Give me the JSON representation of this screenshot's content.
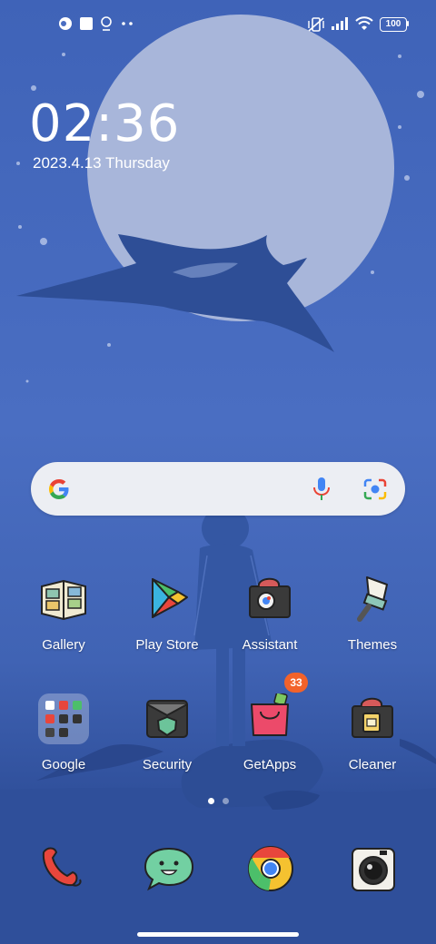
{
  "status_bar": {
    "battery": "100",
    "left_icons": [
      "app-notification-icon",
      "square-notification-icon",
      "location-icon",
      "more-notifications-icon"
    ],
    "right_icons": [
      "mute-vibrate-icon",
      "signal-icon",
      "wifi-icon",
      "battery-icon"
    ]
  },
  "lock_widget": {
    "time_hours": "02",
    "time_sep": ":",
    "time_minutes": "36",
    "date": "2023.4.13 Thursday"
  },
  "search_bar": {
    "icons": [
      "google-logo-icon",
      "mic-icon",
      "lens-camera-icon"
    ]
  },
  "apps_row1": [
    {
      "label": "Gallery",
      "icon": "gallery-icon"
    },
    {
      "label": "Play Store",
      "icon": "play-store-icon"
    },
    {
      "label": "Assistant",
      "icon": "assistant-icon"
    },
    {
      "label": "Themes",
      "icon": "themes-icon"
    }
  ],
  "apps_row2": [
    {
      "label": "Google",
      "icon": "google-folder-icon"
    },
    {
      "label": "Security",
      "icon": "security-icon"
    },
    {
      "label": "GetApps",
      "icon": "getapps-icon",
      "badge": "33"
    },
    {
      "label": "Cleaner",
      "icon": "cleaner-icon"
    }
  ],
  "page_indicator": {
    "pages": 2,
    "current": 1
  },
  "dock": [
    {
      "icon": "phone-icon"
    },
    {
      "icon": "messages-icon"
    },
    {
      "icon": "chrome-icon"
    },
    {
      "icon": "camera-icon"
    }
  ],
  "colors": {
    "wallpaper_blue": "#4a6ec2",
    "moon": "#a8b6da",
    "badge": "#f2622a"
  }
}
